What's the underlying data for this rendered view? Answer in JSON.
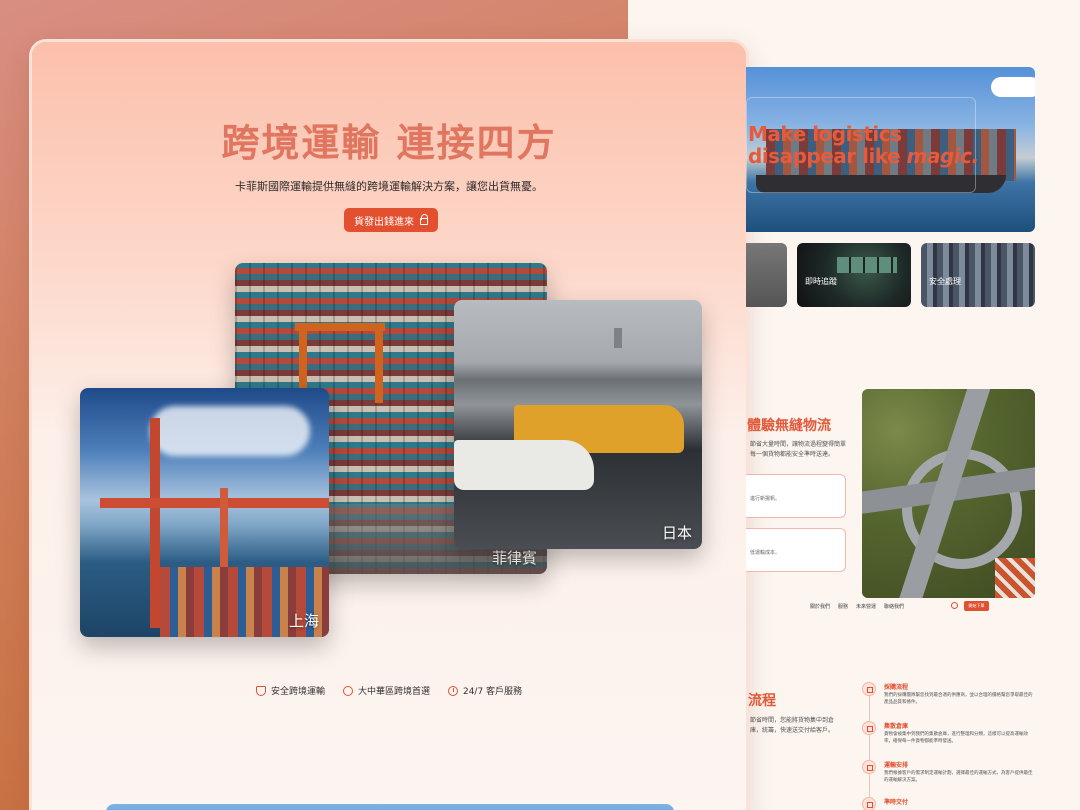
{
  "hero": {
    "title": "跨境運輸 連接四方",
    "subtitle": "卡菲斯國際運輸提供無縫的跨境運輸解決方案，讓您出貨無憂。",
    "button_label": "貨發出錢進來"
  },
  "photos": {
    "philippines": "菲律賓",
    "japan": "日本",
    "shanghai": "上海"
  },
  "features": [
    {
      "label": "安全跨境運輸",
      "icon": "shield-icon"
    },
    {
      "label": "大中華區跨境首選",
      "icon": "globe-icon"
    },
    {
      "label": "24/7 客戶服務",
      "icon": "clock-icon"
    }
  ],
  "right_hero": {
    "line1": "Make logistics",
    "line2": "disappear like",
    "line2_em": "magic."
  },
  "tiles": {
    "tracking": "即時追蹤",
    "safety": "安全處理"
  },
  "experience": {
    "title": "體驗無縫物流",
    "text": "節省大量時間，讓物流過程變得簡單每一個貨物都能安全準時送達。",
    "box1": "進行新揚帆。",
    "box2": "低運輸成本。"
  },
  "mini_nav": {
    "items": [
      "關於我們",
      "服務",
      "未來營運",
      "聯絡我們"
    ],
    "cta": "開始下單"
  },
  "flow": {
    "title": "流程",
    "text": "節省時間，您能將貨物集中到倉庫，統籌，快速送交付給客戶。",
    "steps": [
      {
        "title": "採購流程",
        "desc": "我們的採購團隊幫您找到最合適的供應商，並以合理的價格幫您爭取最佳的產品品質和條件。"
      },
      {
        "title": "集散倉庫",
        "desc": "貨物會被集中到我們的集散倉庫，進行整理和分類，這樣可以提高運輸效率，確保每一件貨物都能準時發送。"
      },
      {
        "title": "運輸安排",
        "desc": "我們根據客戶的需求制定運輸計劃，選擇最佳的運輸方式，為客戶提供最佳的運輸解決方案。"
      },
      {
        "title": "準時交付",
        "desc": ""
      }
    ]
  }
}
